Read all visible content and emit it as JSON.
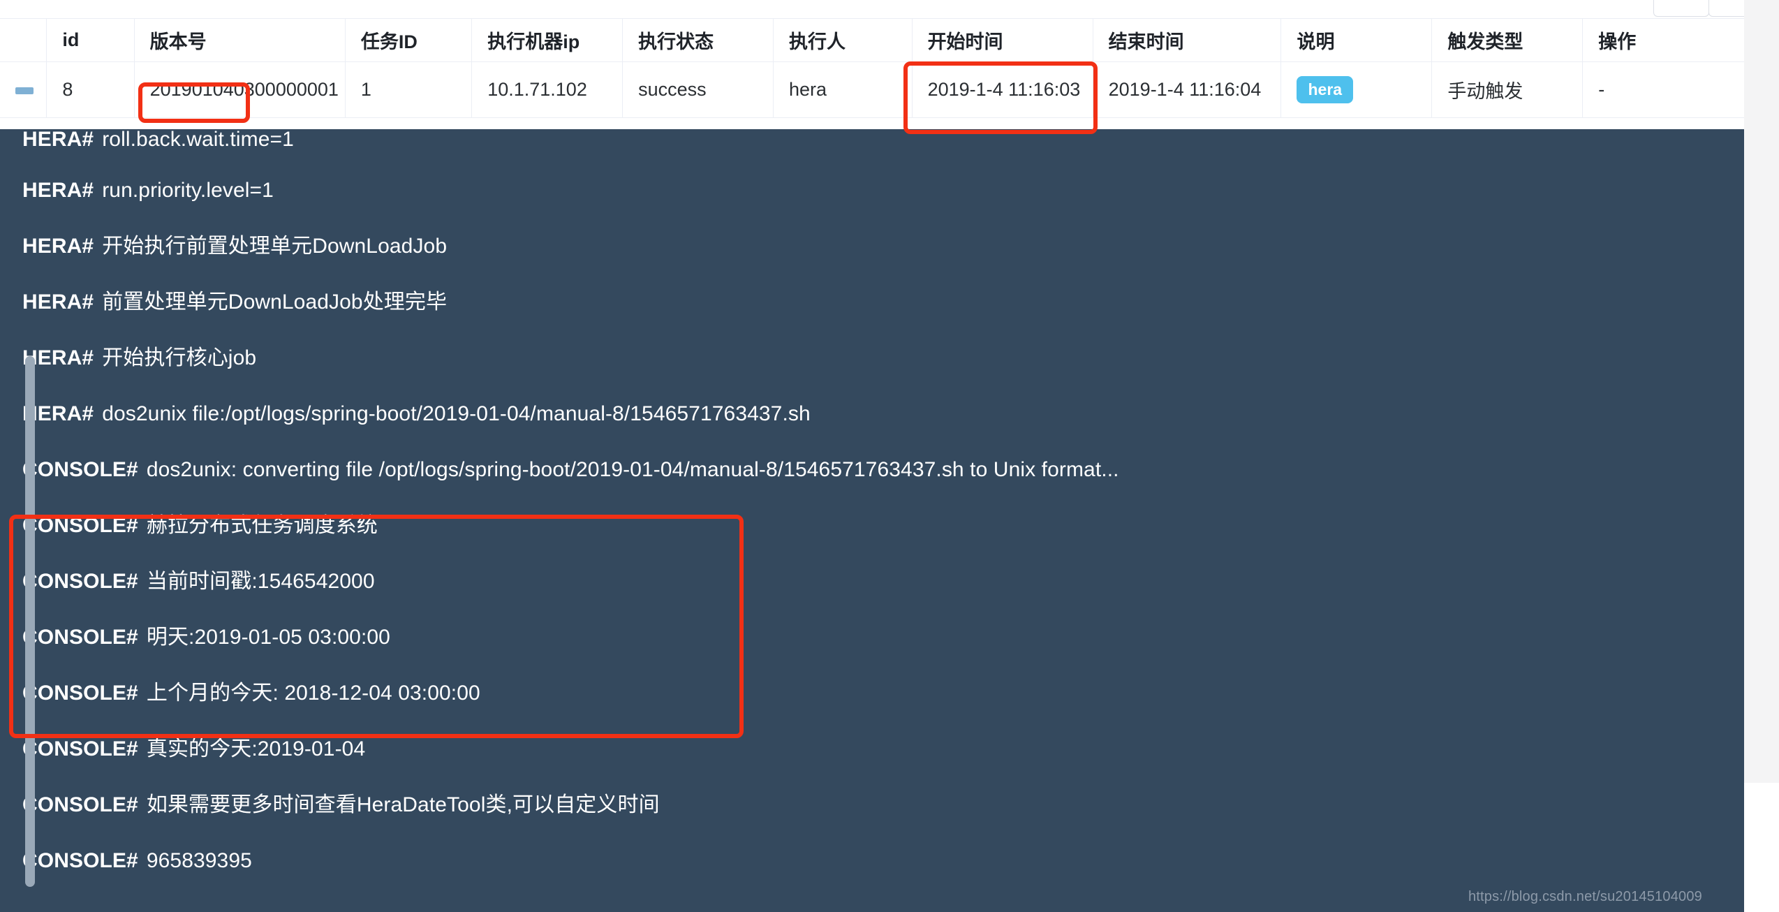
{
  "pagination": {
    "buttons": [
      "",
      ""
    ]
  },
  "table": {
    "columns": [
      {
        "key": "expand",
        "label": ""
      },
      {
        "key": "id",
        "label": "id"
      },
      {
        "key": "version",
        "label": "版本号"
      },
      {
        "key": "taskid",
        "label": "任务ID"
      },
      {
        "key": "ip",
        "label": "执行机器ip"
      },
      {
        "key": "status",
        "label": "执行状态"
      },
      {
        "key": "person",
        "label": "执行人"
      },
      {
        "key": "start",
        "label": "开始时间"
      },
      {
        "key": "end",
        "label": "结束时间"
      },
      {
        "key": "desc",
        "label": "说明"
      },
      {
        "key": "trigger",
        "label": "触发类型"
      },
      {
        "key": "op",
        "label": "操作"
      }
    ],
    "rows": [
      {
        "expand_icon": "collapse-minus-icon",
        "id": "8",
        "version": "201901040300000001",
        "taskid": "1",
        "ip": "10.1.71.102",
        "status": "success",
        "person": "hera",
        "start": "2019-1-4 11:16:03",
        "end": "2019-1-4 11:16:04",
        "desc": "hera",
        "trigger": "手动触发",
        "op": "-"
      }
    ]
  },
  "console": {
    "lines": [
      {
        "tag": "HERA#",
        "msg": "roll.back.wait.time=1"
      },
      {
        "tag": "HERA#",
        "msg": "run.priority.level=1"
      },
      {
        "tag": "HERA#",
        "msg": "开始执行前置处理单元DownLoadJob"
      },
      {
        "tag": "HERA#",
        "msg": "前置处理单元DownLoadJob处理完毕"
      },
      {
        "tag": "HERA#",
        "msg": "开始执行核心job"
      },
      {
        "tag": "HERA#",
        "msg": "dos2unix file:/opt/logs/spring-boot/2019-01-04/manual-8/1546571763437.sh"
      },
      {
        "tag": "CONSOLE#",
        "msg": "dos2unix: converting file /opt/logs/spring-boot/2019-01-04/manual-8/1546571763437.sh to Unix format..."
      },
      {
        "tag": "CONSOLE#",
        "msg": "赫拉分布式任务调度系统"
      },
      {
        "tag": "CONSOLE#",
        "msg": "当前时间戳:1546542000"
      },
      {
        "tag": "CONSOLE#",
        "msg": "明天:2019-01-05 03:00:00"
      },
      {
        "tag": "CONSOLE#",
        "msg": "上个月的今天: 2018-12-04 03:00:00"
      },
      {
        "tag": "CONSOLE#",
        "msg": "真实的今天:2019-01-04"
      },
      {
        "tag": "CONSOLE#",
        "msg": "如果需要更多时间查看HeraDateTool类,可以自定义时间"
      },
      {
        "tag": "CONSOLE#",
        "msg": "965839395"
      }
    ]
  },
  "annotations": {
    "color": "#f23015",
    "boxes": [
      {
        "name": "version-highlight",
        "target": "版本号单元格"
      },
      {
        "name": "start-time-highlight",
        "target": "开始时间单元格"
      },
      {
        "name": "console-output-highlight",
        "target": "CONSOLE 输出区块"
      }
    ]
  },
  "watermark": {
    "text": "https://blog.csdn.net/su20145104009"
  },
  "colors": {
    "console_bg": "#34495e",
    "badge_bg": "#4ec0ed",
    "annotation_red": "#f23015",
    "expand_icon": "#7fb0d4",
    "scrollbar_thumb": "#9aa9b8"
  }
}
